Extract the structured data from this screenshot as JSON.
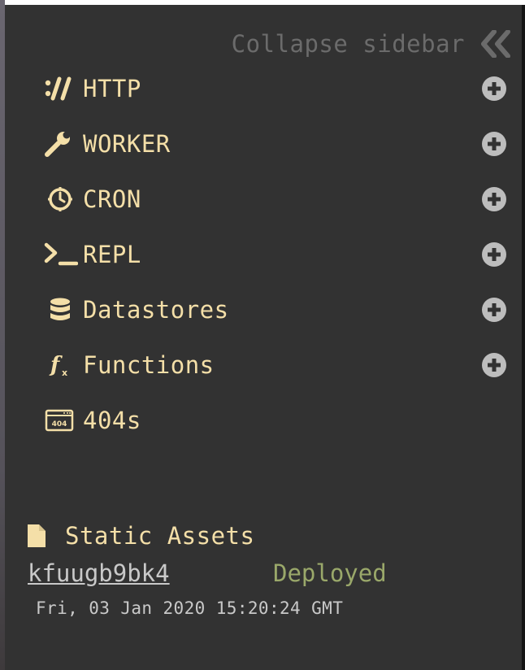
{
  "sidebar": {
    "collapse_label": "Collapse sidebar",
    "items": [
      {
        "label": "HTTP",
        "icon": "http-icon",
        "has_add": true
      },
      {
        "label": "WORKER",
        "icon": "wrench-icon",
        "has_add": true
      },
      {
        "label": "CRON",
        "icon": "clock-icon",
        "has_add": true
      },
      {
        "label": "REPL",
        "icon": "terminal-icon",
        "has_add": true
      },
      {
        "label": "Datastores",
        "icon": "database-icon",
        "has_add": true
      },
      {
        "label": "Functions",
        "icon": "function-icon",
        "has_add": true
      },
      {
        "label": "404s",
        "icon": "404-icon",
        "has_add": false
      }
    ],
    "add_icon": "plus-circle-icon"
  },
  "static_assets": {
    "title": "Static Assets",
    "icon": "file-icon",
    "deploy_id": "kfuugb9bk4",
    "status": "Deployed",
    "timestamp": "Fri, 03 Jan 2020 15:20:24 GMT"
  },
  "colors": {
    "panel_bg": "#323232",
    "accent": "#f4dfa8",
    "muted": "#6b6b6b",
    "status_ok": "#9aa86a",
    "icon_gray": "#bdbdbd"
  }
}
